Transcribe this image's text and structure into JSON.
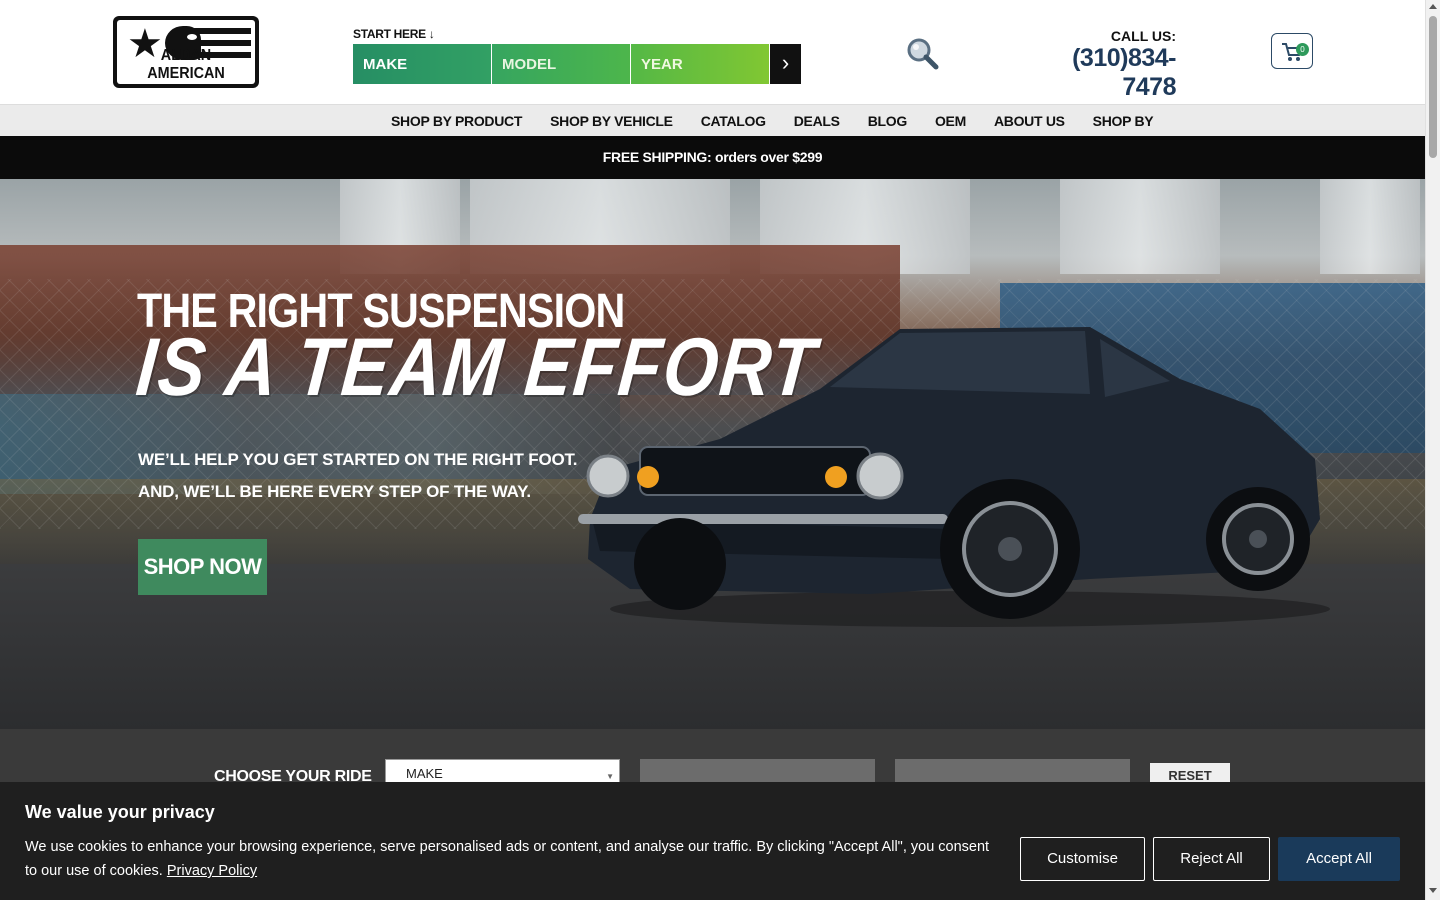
{
  "header": {
    "logo_text": "ALDAN AMERICAN",
    "start_here": "START HERE ↓",
    "vehicle_select": {
      "make": "MAKE",
      "model": "MODEL",
      "year": "YEAR",
      "go": "›"
    },
    "call_label": "CALL US:",
    "phone": "(310)834-7478",
    "cart_count": "0"
  },
  "nav": {
    "items": [
      "SHOP BY PRODUCT",
      "SHOP BY VEHICLE",
      "CATALOG",
      "DEALS",
      "BLOG",
      "OEM",
      "ABOUT US",
      "SHOP BY"
    ]
  },
  "shipping_banner": "FREE SHIPPING: orders over $299",
  "hero": {
    "title_line1": "THE RIGHT SUSPENSION",
    "title_line2": "IS A TEAM EFFORT",
    "sub_line1": "WE’LL HELP YOU GET STARTED ON THE RIGHT FOOT.",
    "sub_line2": "AND, WE’LL BE HERE EVERY STEP OF THE WAY.",
    "cta": "SHOP NOW"
  },
  "ride": {
    "label": "CHOOSE YOUR RIDE",
    "make_value": "MAKE",
    "reset": "RESET"
  },
  "cookie": {
    "title": "We value your privacy",
    "text": "We use cookies to enhance your browsing experience, serve personalised ads or content, and analyse our traffic. By clicking \"Accept All\", you consent to our use of cookies.",
    "link": "Privacy Policy",
    "customise": "Customise",
    "reject": "Reject All",
    "accept": "Accept All"
  },
  "colors": {
    "brand_green": "#3f8a5e",
    "phone_navy": "#1f3a5a",
    "accept_navy": "#1a3a5a"
  }
}
